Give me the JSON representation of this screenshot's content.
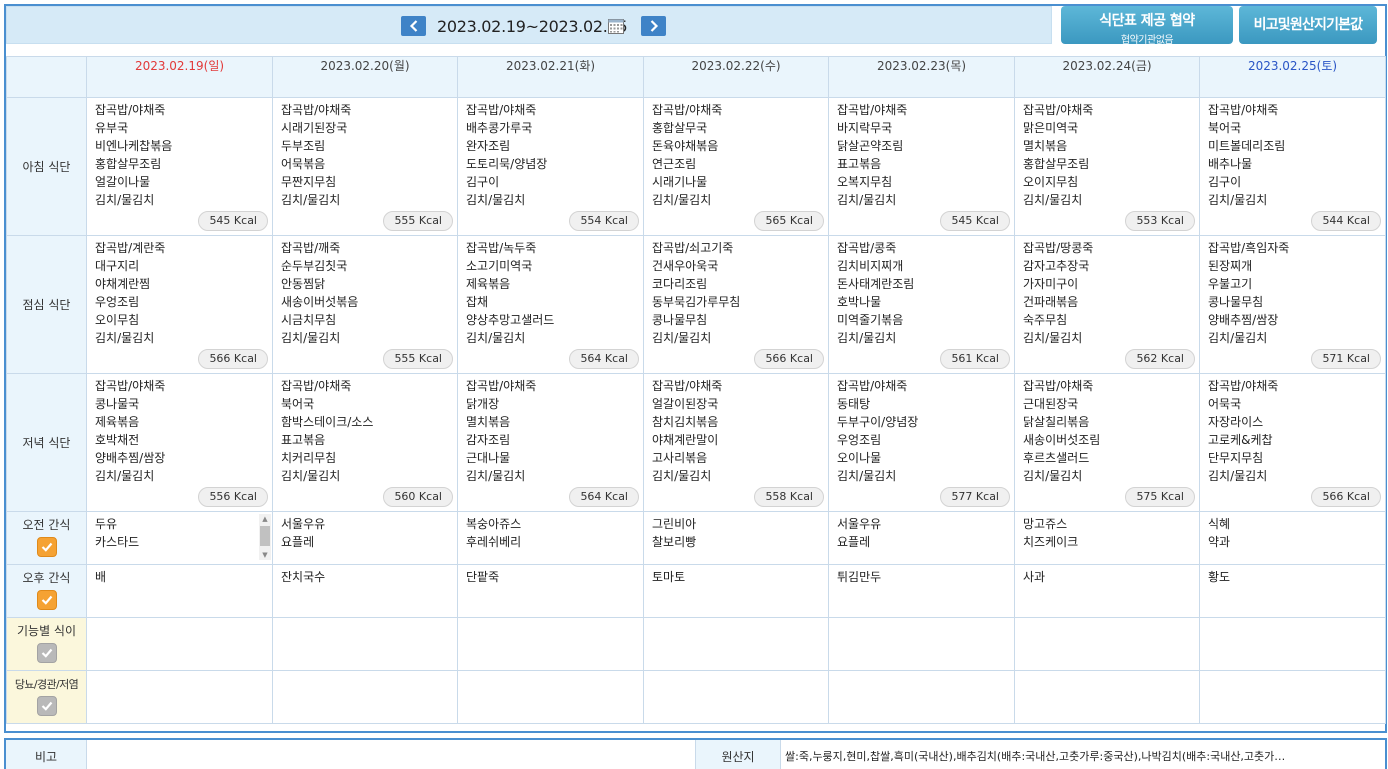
{
  "topbar": {
    "date_range": "2023.02.19~2023.02.25",
    "provide_button": "식단표 제공 협약",
    "provide_sub": "협약기관없음",
    "default_button": "비고및원산지기본값"
  },
  "days": [
    {
      "label": "2023.02.19(일)",
      "color": "#e23a3a"
    },
    {
      "label": "2023.02.20(월)"
    },
    {
      "label": "2023.02.21(화)"
    },
    {
      "label": "2023.02.22(수)"
    },
    {
      "label": "2023.02.23(목)"
    },
    {
      "label": "2023.02.24(금)"
    },
    {
      "label": "2023.02.25(토)",
      "color": "#2a55c6"
    }
  ],
  "rows": {
    "breakfast": "아침 식단",
    "lunch": "점심 식단",
    "dinner": "저녁 식단",
    "am_snack": "오전 간식",
    "pm_snack": "오후 간식",
    "functional": "기능별 식이",
    "diabetic": "당뇨/경관/저염"
  },
  "breakfast": [
    {
      "items": [
        "잡곡밥/야채죽",
        "유부국",
        "비엔나케찹볶음",
        "홍합살무조림",
        "얼갈이나물",
        "김치/물김치"
      ],
      "kcal": "545 Kcal"
    },
    {
      "items": [
        "잡곡밥/야채죽",
        "시래기된장국",
        "두부조림",
        "어묵볶음",
        "무짠지무침",
        "김치/물김치"
      ],
      "kcal": "555 Kcal"
    },
    {
      "items": [
        "잡곡밥/야채죽",
        "배추콩가루국",
        "완자조림",
        "도토리묵/양념장",
        "김구이",
        "김치/물김치"
      ],
      "kcal": "554 Kcal"
    },
    {
      "items": [
        "잡곡밥/야채죽",
        "홍합살무국",
        "돈육야채볶음",
        "연근조림",
        "시래기나물",
        "김치/물김치"
      ],
      "kcal": "565 Kcal"
    },
    {
      "items": [
        "잡곡밥/야채죽",
        "바지락무국",
        "닭살곤약조림",
        "표고볶음",
        "오복지무침",
        "김치/물김치"
      ],
      "kcal": "545 Kcal"
    },
    {
      "items": [
        "잡곡밥/야채죽",
        "맑은미역국",
        "멸치볶음",
        "홍합살무조림",
        "오이지무침",
        "김치/물김치"
      ],
      "kcal": "553 Kcal"
    },
    {
      "items": [
        "잡곡밥/야채죽",
        "북어국",
        "미트볼데리조림",
        "배추나물",
        "김구이",
        "김치/물김치"
      ],
      "kcal": "544 Kcal"
    }
  ],
  "lunch": [
    {
      "items": [
        "잡곡밥/계란죽",
        "대구지리",
        "야채계란찜",
        "우엉조림",
        "오이무침",
        "김치/물김치"
      ],
      "kcal": "566 Kcal"
    },
    {
      "items": [
        "잡곡밥/깨죽",
        "순두부김칫국",
        "안동찜닭",
        "새송이버섯볶음",
        "시금치무침",
        "김치/물김치"
      ],
      "kcal": "555 Kcal"
    },
    {
      "items": [
        "잡곡밥/녹두죽",
        "소고기미역국",
        "제육볶음",
        "잡채",
        "양상추망고샐러드",
        "김치/물김치"
      ],
      "kcal": "564 Kcal"
    },
    {
      "items": [
        "잡곡밥/쇠고기죽",
        "건새우아욱국",
        "코다리조림",
        "동부묵김가루무침",
        "콩나물무침",
        "김치/물김치"
      ],
      "kcal": "566 Kcal"
    },
    {
      "items": [
        "잡곡밥/콩죽",
        "김치비지찌개",
        "돈사태계란조림",
        "호박나물",
        "미역줄기볶음",
        "김치/물김치"
      ],
      "kcal": "561 Kcal"
    },
    {
      "items": [
        "잡곡밥/땅콩죽",
        "감자고추장국",
        "가자미구이",
        "건파래볶음",
        "숙주무침",
        "김치/물김치"
      ],
      "kcal": "562 Kcal"
    },
    {
      "items": [
        "잡곡밥/흑임자죽",
        "된장찌개",
        "우불고기",
        "콩나물무침",
        "양배추찜/쌈장",
        "김치/물김치"
      ],
      "kcal": "571 Kcal"
    }
  ],
  "dinner": [
    {
      "items": [
        "잡곡밥/야채죽",
        "콩나물국",
        "제육볶음",
        "호박채전",
        "양배추찜/쌈장",
        "김치/물김치"
      ],
      "kcal": "556 Kcal"
    },
    {
      "items": [
        "잡곡밥/야채죽",
        "북어국",
        "함박스테이크/소스",
        "표고볶음",
        "치커리무침",
        "김치/물김치"
      ],
      "kcal": "560 Kcal"
    },
    {
      "items": [
        "잡곡밥/야채죽",
        "닭개장",
        "멸치볶음",
        "감자조림",
        "근대나물",
        "김치/물김치"
      ],
      "kcal": "564 Kcal"
    },
    {
      "items": [
        "잡곡밥/야채죽",
        "얼갈이된장국",
        "참치김치볶음",
        "야채계란말이",
        "고사리볶음",
        "김치/물김치"
      ],
      "kcal": "558 Kcal"
    },
    {
      "items": [
        "잡곡밥/야채죽",
        "동태탕",
        "두부구이/양념장",
        "우엉조림",
        "오이나물",
        "김치/물김치"
      ],
      "kcal": "577 Kcal"
    },
    {
      "items": [
        "잡곡밥/야채죽",
        "근대된장국",
        "닭살칠리볶음",
        "새송이버섯조림",
        "후르츠샐러드",
        "김치/물김치"
      ],
      "kcal": "575 Kcal"
    },
    {
      "items": [
        "잡곡밥/야채죽",
        "어묵국",
        "자장라이스",
        "고로케&케찹",
        "단무지무침",
        "김치/물김치"
      ],
      "kcal": "566 Kcal"
    }
  ],
  "am_snack": [
    [
      "두유",
      "카스타드"
    ],
    [
      "서울우유",
      "요플레"
    ],
    [
      "복숭아쥬스",
      "후레쉬베리"
    ],
    [
      "그린비아",
      "찰보리빵"
    ],
    [
      "서울우유",
      "요플레"
    ],
    [
      "망고쥬스",
      "치즈케이크"
    ],
    [
      "식혜",
      "약과"
    ]
  ],
  "pm_snack": [
    "배",
    "잔치국수",
    "단팥죽",
    "토마토",
    "튀김만두",
    "사과",
    "황도"
  ],
  "bottom": {
    "memo_label": "비고",
    "origin_label": "원산지",
    "origin_text": "쌀:죽,누룽지,현미,찹쌀,흑미(국내산),배추김치(배추:국내산,고춧가루:중국산),나박김치(배추:국내산,고춧가…"
  },
  "colors": {
    "accent": "#3f83c7",
    "sunday": "#e23a3a",
    "saturday": "#2a55c6",
    "checkbox_on": "#f5a233",
    "checkbox_off": "#b9b9b9"
  }
}
